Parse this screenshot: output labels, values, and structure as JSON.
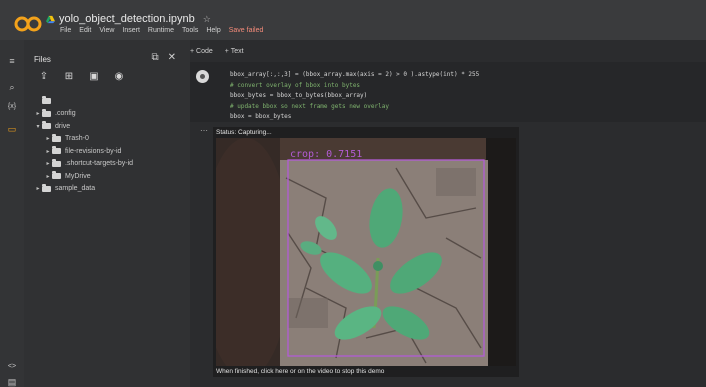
{
  "header": {
    "notebook_title": "yolo_object_detection.ipynb",
    "menu": [
      "File",
      "Edit",
      "View",
      "Insert",
      "Runtime",
      "Tools",
      "Help"
    ],
    "save_status": "Save failed"
  },
  "files_panel": {
    "title": "Files",
    "tree": [
      {
        "label": ".config",
        "depth": 1
      },
      {
        "label": "drive",
        "depth": 1
      },
      {
        "label": "Trash-0",
        "depth": 2
      },
      {
        "label": "file-revisions-by-id",
        "depth": 2
      },
      {
        "label": ".shortcut-targets-by-id",
        "depth": 2
      },
      {
        "label": "MyDrive",
        "depth": 2
      },
      {
        "label": "sample_data",
        "depth": 1
      }
    ]
  },
  "cell_toolbar": {
    "add_code": "+ Code",
    "add_text": "+ Text"
  },
  "code_cell": {
    "lines": [
      "bbox_array[:,:,3] = (bbox_array.max(axis = 2) > 0 ).astype(int) * 255",
      "# convert overlay of bbox into bytes",
      "bbox_bytes = bbox_to_bytes(bbox_array)",
      "# update bbox so next frame gets new overlay",
      "bbox = bbox_bytes"
    ]
  },
  "output": {
    "status_text": "Status: Capturing...",
    "detection_label": "crop: 0.7151",
    "finish_text": "When finished, click here or on the video to stop this demo"
  },
  "colors": {
    "bbox": "#b35cd6",
    "save_failed": "#f48b7a",
    "comment": "#7fb36e"
  }
}
